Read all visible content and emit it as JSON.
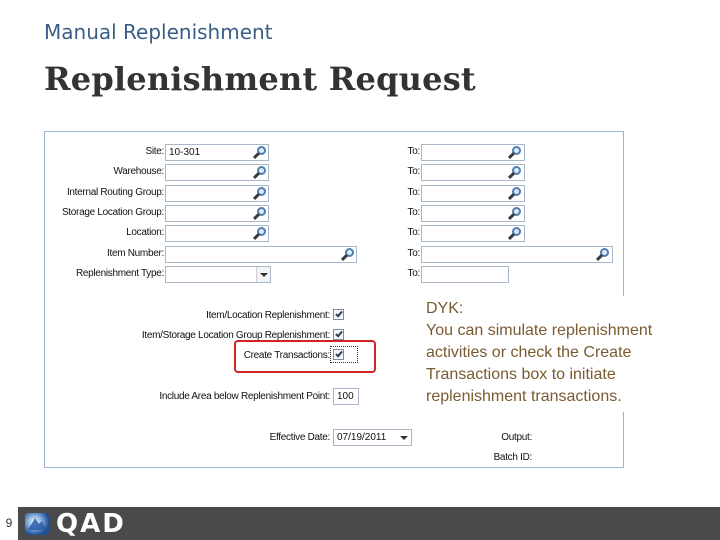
{
  "section_title": "Manual Replenishment",
  "slide_title": "Replenishment Request",
  "form": {
    "site_label": "Site:",
    "site_value": "10-301",
    "warehouse_label": "Warehouse:",
    "routing_group_label": "Internal Routing Group:",
    "storage_group_label": "Storage Location Group:",
    "location_label": "Location:",
    "item_number_label": "Item Number:",
    "replenishment_type_label": "Replenishment Type:",
    "to_labels": [
      "To:",
      "To:",
      "To:",
      "To:",
      "To:",
      "To:",
      "To:"
    ],
    "item_location_repl_label": "Item/Location Replenishment:",
    "item_storage_group_repl_label": "Item/Storage Location Group Replenishment:",
    "create_transactions_label": "Create Transactions:",
    "include_area_label": "Include Area below Replenishment Point:",
    "include_area_value": "100",
    "effective_date_label": "Effective Date:",
    "effective_date_value": "07/19/2011",
    "output_label": "Output:",
    "batch_id_label": "Batch ID:",
    "checkboxes": {
      "item_location_repl": true,
      "item_storage_group_repl": true,
      "create_transactions": true
    }
  },
  "callout": {
    "text": "DYK:\nYou can simulate replenishment activities or check the Create Transactions box to initiate replenishment transactions."
  },
  "footer": {
    "page_number": "9",
    "brand": "QAD"
  },
  "colors": {
    "section_title": "#3a5d86",
    "callout_text": "#7a5a30",
    "highlight": "#d12525",
    "footer_bar": "#4a4a4a"
  }
}
